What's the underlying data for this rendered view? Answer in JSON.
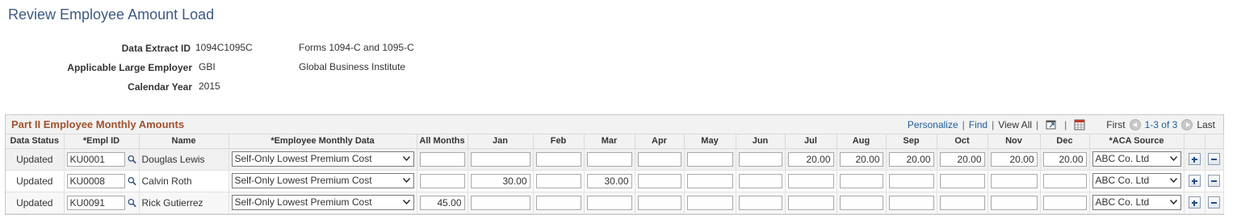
{
  "page": {
    "title": "Review Employee Amount Load"
  },
  "info": {
    "data_extract_label": "Data Extract ID",
    "data_extract_value": "1094C1095C",
    "data_extract_desc": "Forms 1094-C and 1095-C",
    "ale_label": "Applicable Large Employer",
    "ale_value": "GBI",
    "ale_desc": "Global Business Institute",
    "calendar_label": "Calendar Year",
    "calendar_value": "2015"
  },
  "grid": {
    "title": "Part II Employee Monthly Amounts",
    "nav": {
      "personalize": "Personalize",
      "find": "Find",
      "view_all": "View All",
      "first": "First",
      "range": "1-3 of 3",
      "last": "Last"
    },
    "headers": {
      "data_status": "Data Status",
      "empl_id": "*Empl ID",
      "name": "Name",
      "monthly_data": "*Employee Monthly Data",
      "all_months": "All Months",
      "jan": "Jan",
      "feb": "Feb",
      "mar": "Mar",
      "apr": "Apr",
      "may": "May",
      "jun": "Jun",
      "jul": "Jul",
      "aug": "Aug",
      "sep": "Sep",
      "oct": "Oct",
      "nov": "Nov",
      "dec": "Dec",
      "aca_source": "*ACA Source"
    },
    "rows": [
      {
        "status": "Updated",
        "emplid": "KU0001",
        "name": "Douglas Lewis",
        "monthly_data": "Self-Only Lowest Premium Cost",
        "all_months": "",
        "jan": "",
        "feb": "",
        "mar": "",
        "apr": "",
        "may": "",
        "jun": "",
        "jul": "20.00",
        "aug": "20.00",
        "sep": "20.00",
        "oct": "20.00",
        "nov": "20.00",
        "dec": "20.00",
        "aca_source": "ABC Co. Ltd"
      },
      {
        "status": "Updated",
        "emplid": "KU0008",
        "name": "Calvin Roth",
        "monthly_data": "Self-Only Lowest Premium Cost",
        "all_months": "",
        "jan": "30.00",
        "feb": "",
        "mar": "30.00",
        "apr": "",
        "may": "",
        "jun": "",
        "jul": "",
        "aug": "",
        "sep": "",
        "oct": "",
        "nov": "",
        "dec": "",
        "aca_source": "ABC Co. Ltd"
      },
      {
        "status": "Updated",
        "emplid": "KU0091",
        "name": "Rick Gutierrez",
        "monthly_data": "Self-Only Lowest Premium Cost",
        "all_months": "45.00",
        "jan": "",
        "feb": "",
        "mar": "",
        "apr": "",
        "may": "",
        "jun": "",
        "jul": "",
        "aug": "",
        "sep": "",
        "oct": "",
        "nov": "",
        "dec": "",
        "aca_source": "ABC Co. Ltd"
      }
    ]
  },
  "colors": {
    "title": "#3d5a80",
    "grid_title": "#a0522d",
    "link": "#1f5c99"
  }
}
